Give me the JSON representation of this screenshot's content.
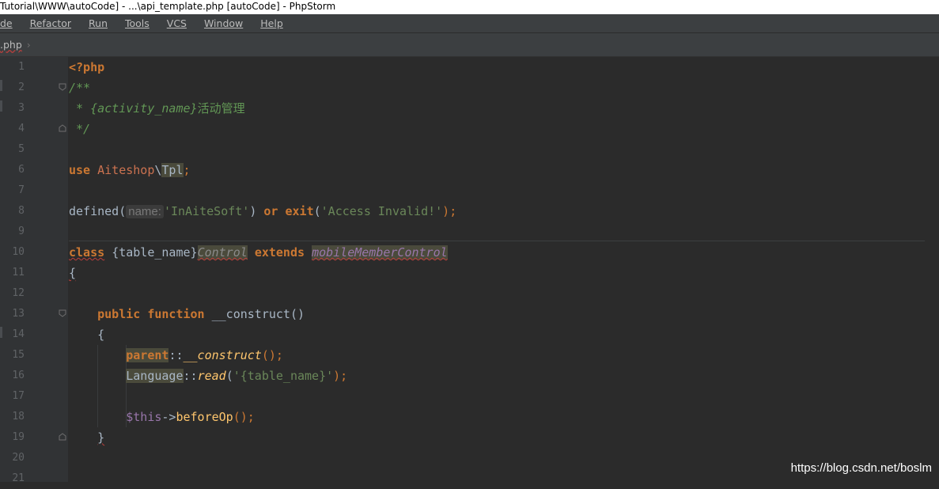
{
  "window": {
    "title": "Tutorial\\WWW\\autoCode] - ...\\api_template.php [autoCode] - PhpStorm"
  },
  "menu": {
    "items": [
      {
        "label": "de"
      },
      {
        "label": "Refactor"
      },
      {
        "label": "Run"
      },
      {
        "label": "Tools"
      },
      {
        "label": "VCS"
      },
      {
        "label": "Window"
      },
      {
        "label": "Help"
      }
    ]
  },
  "breadcrumb": {
    "file": ".php"
  },
  "editor": {
    "line_numbers": [
      "1",
      "2",
      "3",
      "4",
      "5",
      "6",
      "7",
      "8",
      "9",
      "10",
      "11",
      "12",
      "13",
      "14",
      "15",
      "16",
      "17",
      "18",
      "19",
      "20",
      "21"
    ],
    "lines": {
      "l1": {
        "open_tag": "<?php"
      },
      "l2": {
        "comment": "/**"
      },
      "l3": {
        "comment": " * {activity_name}",
        "comment_cn": "活动管理"
      },
      "l4": {
        "comment": " */"
      },
      "l6": {
        "kw": "use",
        "ns": "Aiteshop",
        "sep": "\\",
        "cls": "Tpl",
        "semi": ";"
      },
      "l8": {
        "fn": "defined(",
        "hint": "name:",
        "str1": "'InAiteSoft'",
        "close": ")",
        "or": "or",
        "exit": "exit",
        "paren": "(",
        "str2": "'Access Invalid!'",
        "end": ");"
      },
      "l10": {
        "kw": "class",
        "name": "{table_name}",
        "suffix": "Control",
        "extends": "extends",
        "parent": "mobileMemberControl"
      },
      "l11": {
        "brace": "{"
      },
      "l13": {
        "public": "public",
        "function": "function",
        "name": "__construct",
        "parens": "()"
      },
      "l14": {
        "brace": "{"
      },
      "l15": {
        "parent": "parent",
        "dc": "::",
        "method": "__construct",
        "end": "();"
      },
      "l16": {
        "cls": "Language",
        "dc": "::",
        "method": "read",
        "open": "(",
        "str": "'{table_name}'",
        "end": ");"
      },
      "l18": {
        "var": "$this",
        "arrow": "->",
        "method": "beforeOp",
        "end": "();"
      },
      "l19": {
        "brace": "}"
      }
    }
  },
  "watermark": "https://blog.csdn.net/boslm"
}
